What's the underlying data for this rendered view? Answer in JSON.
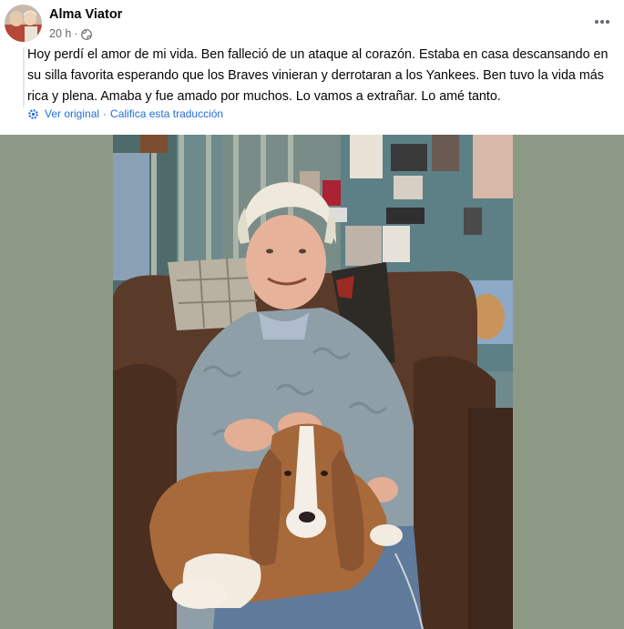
{
  "post": {
    "author": "Alma Viator",
    "time": "20 h",
    "separator": "·",
    "privacy_icon": "globe-icon",
    "more_icon": "more-options-icon",
    "text": "Hoy perdí el amor de mi vida. Ben falleció de un ataque al corazón. Estaba en casa descansando en su silla favorita esperando que los Braves vinieran y derrotaran a los Yankees. Ben tuvo la vida más rica y plena. Amaba y fue amado por muchos. Lo vamos a extrañar. Lo amé tanto.",
    "translation": {
      "icon": "translate-gear-icon",
      "view_original": "Ver original",
      "separator": "·",
      "rate_translation": "Califica esta traducción"
    }
  },
  "colors": {
    "link_blue": "#216fdb",
    "photo_background": "#8c9a85",
    "secondary_text": "#65676b"
  }
}
